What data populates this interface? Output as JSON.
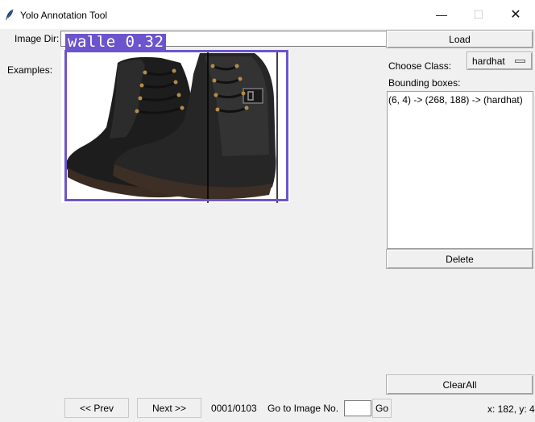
{
  "window": {
    "title": "Yolo Annotation Tool",
    "minimize_glyph": "—",
    "maximize_glyph": "☐",
    "close_glyph": "✕"
  },
  "toolbar": {
    "image_dir_label": "Image Dir:",
    "image_dir_value": "",
    "load_button": "Load"
  },
  "examples_label": "Examples:",
  "canvas": {
    "annotation_label": "walle 0.32",
    "box_color": "#6c55cc"
  },
  "side": {
    "choose_class_label": "Choose Class:",
    "selected_class": "hardhat",
    "bounding_boxes_label": "Bounding boxes:",
    "boxes": [
      "(6, 4) -> (268, 188) -> (hardhat)"
    ],
    "delete_button": "Delete",
    "clear_all_button": "ClearAll"
  },
  "nav": {
    "prev_button": "<< Prev",
    "next_button": "Next >>",
    "progress": "0001/0103",
    "goto_label": "Go to Image No.",
    "goto_value": "",
    "go_button": "Go",
    "coords": "x: 182, y: 4"
  },
  "icons": {
    "app": "feather-icon",
    "minimize": "minimize-icon",
    "maximize": "maximize-icon",
    "close": "close-icon"
  }
}
